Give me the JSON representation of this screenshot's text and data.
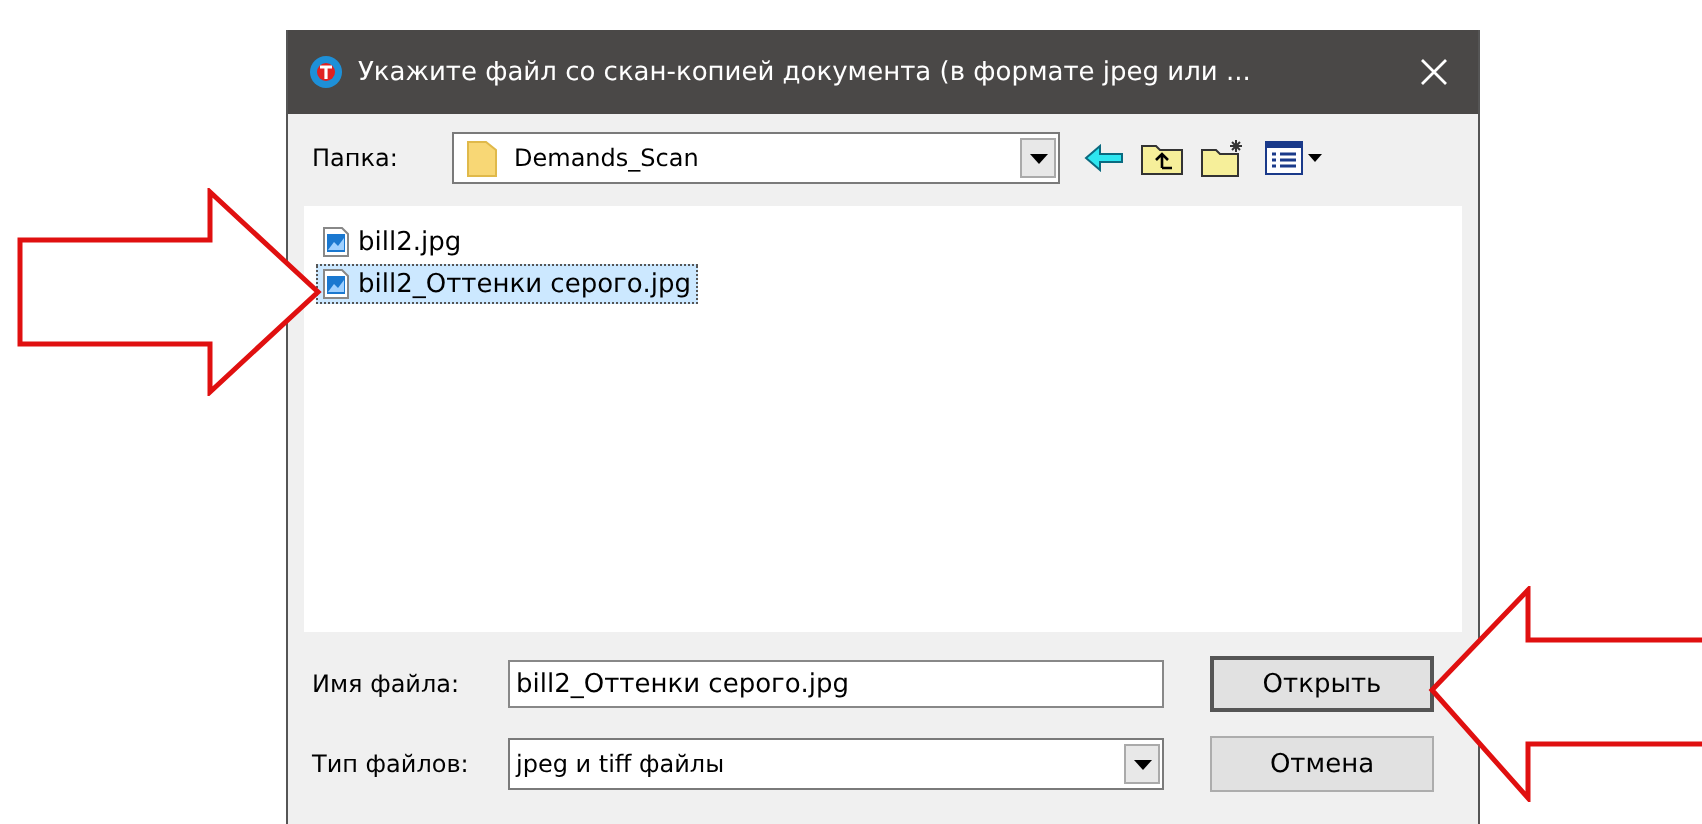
{
  "window": {
    "title": "Укажите файл со скан-копией документа (в формате jpeg или ..."
  },
  "folder": {
    "label": "Папка:",
    "value": "Demands_Scan"
  },
  "files": [
    {
      "name": "bill2.jpg",
      "selected": false
    },
    {
      "name": "bill2_Оттенки серого.jpg",
      "selected": true
    }
  ],
  "filename": {
    "label": "Имя файла:",
    "value": "bill2_Оттенки серого.jpg"
  },
  "filetype": {
    "label": "Тип файлов:",
    "value": "jpeg и tiff файлы"
  },
  "buttons": [
    {
      "label": "Открыть",
      "default": true
    },
    {
      "label": "Отмена",
      "default": false
    }
  ]
}
